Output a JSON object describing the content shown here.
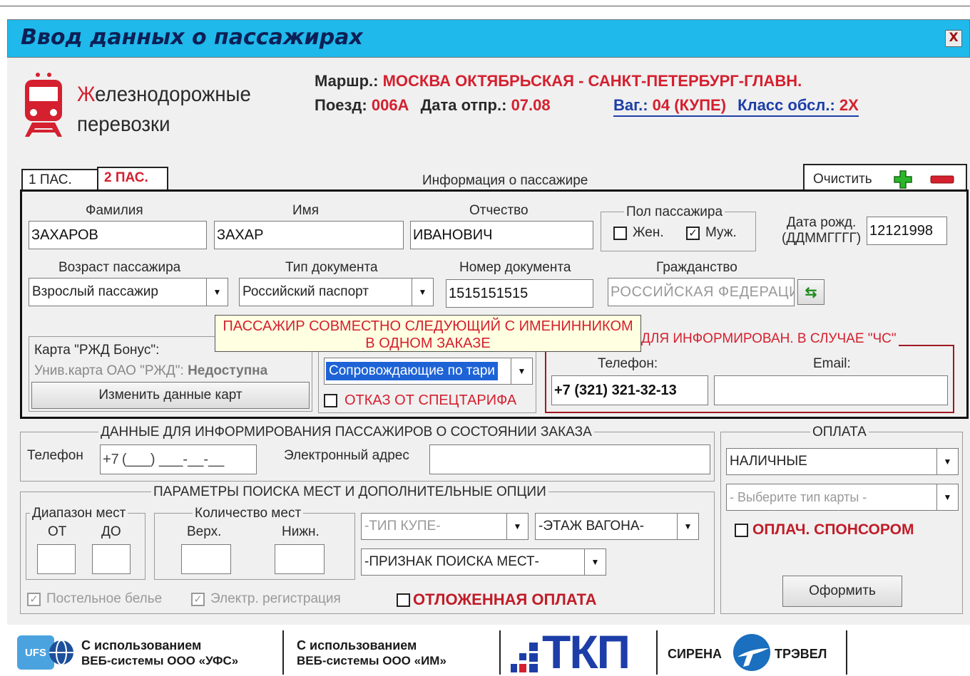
{
  "window": {
    "title": "Ввод данных о пассажирах",
    "close_label": "X"
  },
  "logo": {
    "line1_first": "Ж",
    "line1_rest": "елезнодорожные",
    "line2": "перевозки"
  },
  "trip": {
    "route_label": "Маршр.:",
    "route_value": "МОСКВА ОКТЯБРЬСКАЯ - САНКТ-ПЕТЕРБУРГ-ГЛАВН.",
    "train_label": "Поезд:",
    "train_value": "006А",
    "date_label": "Дата отпр.:",
    "date_value": "07.08",
    "car_label": "Ваг.:",
    "car_value": "04 (КУПЕ)",
    "class_label": "Класс обсл.:",
    "class_value": "2Х"
  },
  "tabs": [
    {
      "label": "1 ПАС."
    },
    {
      "label": "2 ПАС."
    }
  ],
  "passenger_info_title": "Информация о пассажире",
  "clear_label": "Очистить",
  "form": {
    "surname_label": "Фамилия",
    "surname_value": "ЗАХАРОВ",
    "name_label": "Имя",
    "name_value": "ЗАХАР",
    "patronymic_label": "Отчество",
    "patronymic_value": "ИВАНОВИЧ",
    "gender_legend": "Пол пассажира",
    "female_label": "Жен.",
    "male_label": "Муж.",
    "birth_label_1": "Дата рожд.",
    "birth_label_2": "(ДДММГГГГ)",
    "birth_value": "12121998",
    "age_label": "Возраст пассажира",
    "age_value": "Взрослый пассажир",
    "doctype_label": "Тип документа",
    "doctype_value": "Российский паспорт",
    "docnum_label": "Номер документа",
    "docnum_value": "1515151515",
    "citizenship_label": "Гражданство",
    "citizenship_value": "РОССИЙСКАЯ ФЕДЕРАЦИ"
  },
  "tooltip": {
    "line1": "ПАССАЖИР СОВМЕСТНО СЛЕДУЮЩИЙ С ИМЕНИННИКОМ",
    "line2": "В ОДНОМ ЗАКАЗЕ"
  },
  "cards": {
    "rzd_bonus_label": "Карта \"РЖД Бонус\":",
    "univ_label": "Унив.карта ОАО \"РЖД\":",
    "univ_value": "Недоступна",
    "change_button": "Изменить данные карт"
  },
  "tariff": {
    "value": "Сопровождающие по тари",
    "refuse_label": "ОТКАЗ ОТ СПЕЦТАРИФА"
  },
  "emergency": {
    "legend": "ДЛЯ ИНФОРМИРОВАН. В СЛУЧАЕ \"ЧС\"",
    "phone_label": "Телефон:",
    "email_label": "Email:",
    "phone_value": "+7 (321) 321-32-13",
    "email_value": ""
  },
  "notify": {
    "legend": "ДАННЫЕ ДЛЯ ИНФОРМИРОВАНИЯ ПАССАЖИРОВ О СОСТОЯНИИ ЗАКАЗА",
    "phone_label": "Телефон",
    "phone_prefix": "+7",
    "phone_mask": "(___) ___-__-__",
    "email_label": "Электронный адрес",
    "email_value": ""
  },
  "payment": {
    "legend": "ОПЛАТА",
    "method_value": "НАЛИЧНЫЕ",
    "card_placeholder": "- Выберите тип карты -",
    "sponsor_label": "ОПЛАЧ. СПОНСОРОМ",
    "submit_label": "Оформить"
  },
  "search": {
    "legend": "ПАРАМЕТРЫ ПОИСКА МЕСТ И ДОПОЛНИТЕЛЬНЫЕ ОПЦИИ",
    "range_legend": "Диапазон мест",
    "from_label": "ОТ",
    "to_label": "ДО",
    "count_legend": "Количество мест",
    "upper_label": "Верх.",
    "lower_label": "Нижн.",
    "compartment_type": "-ТИП КУПЕ-",
    "floor": "-ЭТАЖ ВАГОНА-",
    "seat_sign": "-ПРИЗНАК ПОИСКА МЕСТ-",
    "linen_label": "Постельное белье",
    "ereg_label": "Электр. регистрация",
    "deferred_label": "ОТЛОЖЕННАЯ ОПЛАТА"
  },
  "footer": {
    "ufs_badge": "UFS",
    "ufs_line1": "С использованием",
    "ufs_line2": "ВЕБ-системы ООО «УФС»",
    "im_line1": "С использованием",
    "im_line2": "ВЕБ-системы ООО «ИМ»",
    "tkp_logo": "ТКП",
    "sirena_left": "СИРЕНА",
    "sirena_right": "ТРЭВЕЛ"
  },
  "colors": {
    "title_bar": "#1fb9ec",
    "accent_red": "#d4202f",
    "accent_blue": "#1d3ea8",
    "tooltip_bg": "#ffffe1"
  }
}
